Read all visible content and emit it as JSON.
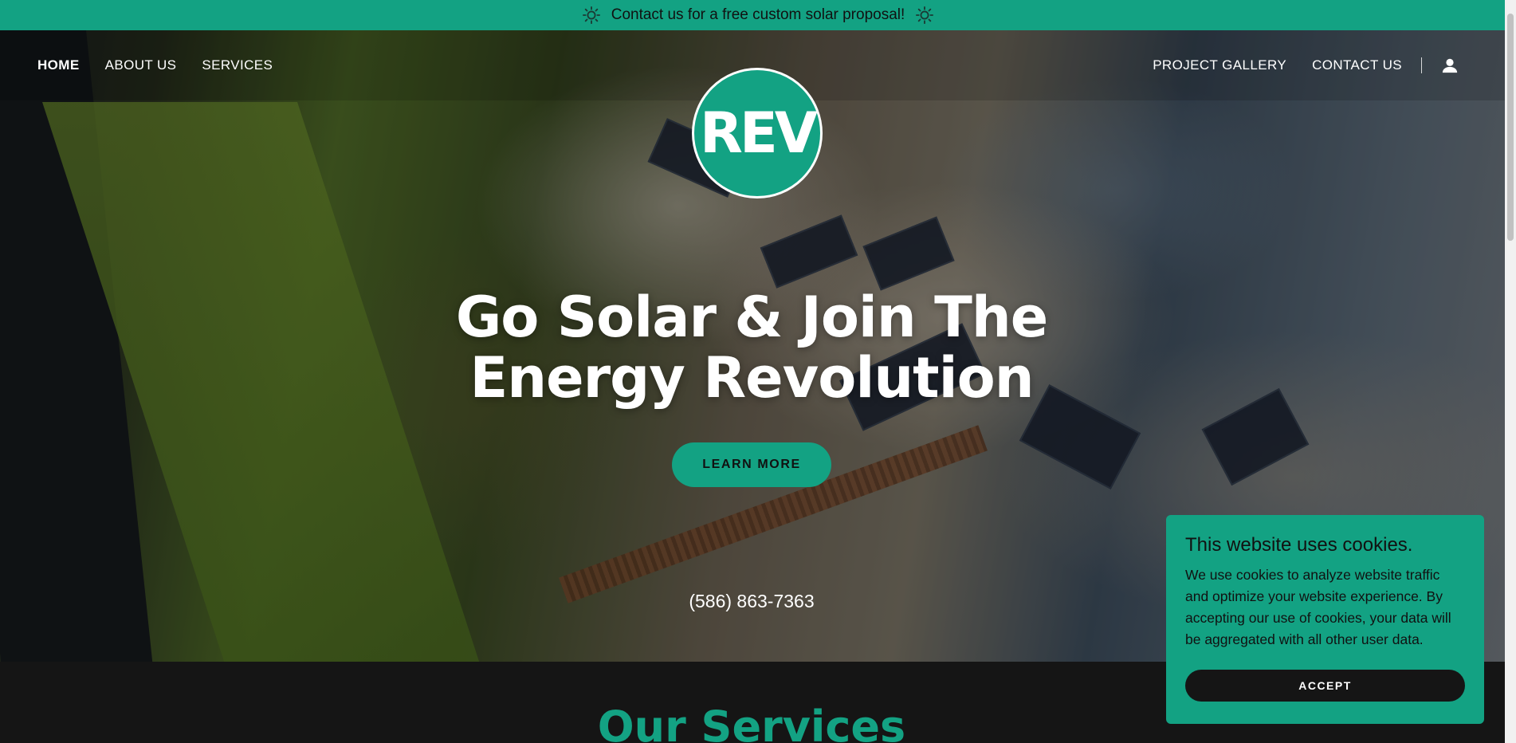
{
  "announcement": {
    "text": "Contact us for a free custom solar proposal!",
    "icon": "sun-icon"
  },
  "nav": {
    "left": [
      "HOME",
      "ABOUT US",
      "SERVICES"
    ],
    "right": [
      "PROJECT GALLERY",
      "CONTACT US"
    ],
    "active": "HOME",
    "account_icon": "user-icon"
  },
  "logo": {
    "text": "REV"
  },
  "hero": {
    "headline": "Go Solar & Join The Energy Revolution",
    "cta_label": "LEARN MORE",
    "phone": "(586) 863-7363"
  },
  "services": {
    "title": "Our Services"
  },
  "cookie": {
    "title": "This website uses cookies.",
    "body": "We use cookies to analyze website traffic and optimize your website experience. By accepting our use of cookies, your data will be aggregated with all other user data.",
    "accept_label": "ACCEPT"
  },
  "colors": {
    "brand": "#13a283",
    "dark": "#151515",
    "text": "#ffffff"
  }
}
